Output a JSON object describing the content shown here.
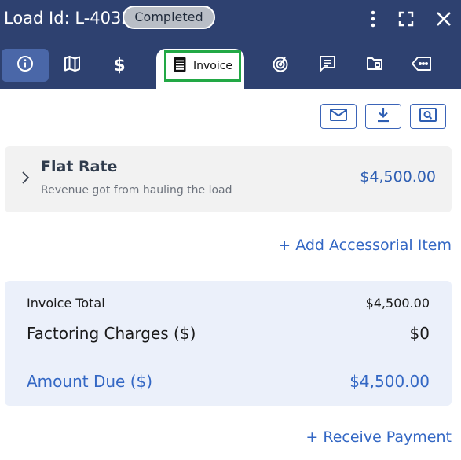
{
  "header": {
    "title": "Load Id: L-4032",
    "status": "Completed",
    "icons": [
      "more-vertical-icon",
      "fullscreen-icon",
      "close-icon"
    ]
  },
  "tabs": [
    {
      "name": "info",
      "icon": "info-icon",
      "active": true
    },
    {
      "name": "map",
      "icon": "map-icon"
    },
    {
      "name": "pricing",
      "icon": "dollar-icon"
    },
    {
      "name": "invoice",
      "icon": "invoice-icon",
      "label": "Invoice",
      "selected": true
    },
    {
      "name": "tracking",
      "icon": "radar-icon"
    },
    {
      "name": "notes",
      "icon": "message-icon"
    },
    {
      "name": "documents",
      "icon": "folder-icon"
    },
    {
      "name": "tags",
      "icon": "tag-icon"
    }
  ],
  "actions": [
    "email-icon",
    "download-icon",
    "preview-icon"
  ],
  "line_item": {
    "title": "Flat Rate",
    "description": "Revenue got from hauling the load",
    "amount": "$4,500.00"
  },
  "add_accessorial": "+ Add Accessorial Item",
  "totals": {
    "invoice_total_label": "Invoice Total",
    "invoice_total_value": "$4,500.00",
    "factoring_label": "Factoring Charges ($)",
    "factoring_value": "$0",
    "amount_due_label": "Amount Due ($)",
    "amount_due_value": "$4,500.00"
  },
  "receive_payment": "+ Receive Payment",
  "colors": {
    "header_bg": "#2e4170",
    "accent_blue": "#3367c4",
    "selected_outline": "#22a845"
  }
}
